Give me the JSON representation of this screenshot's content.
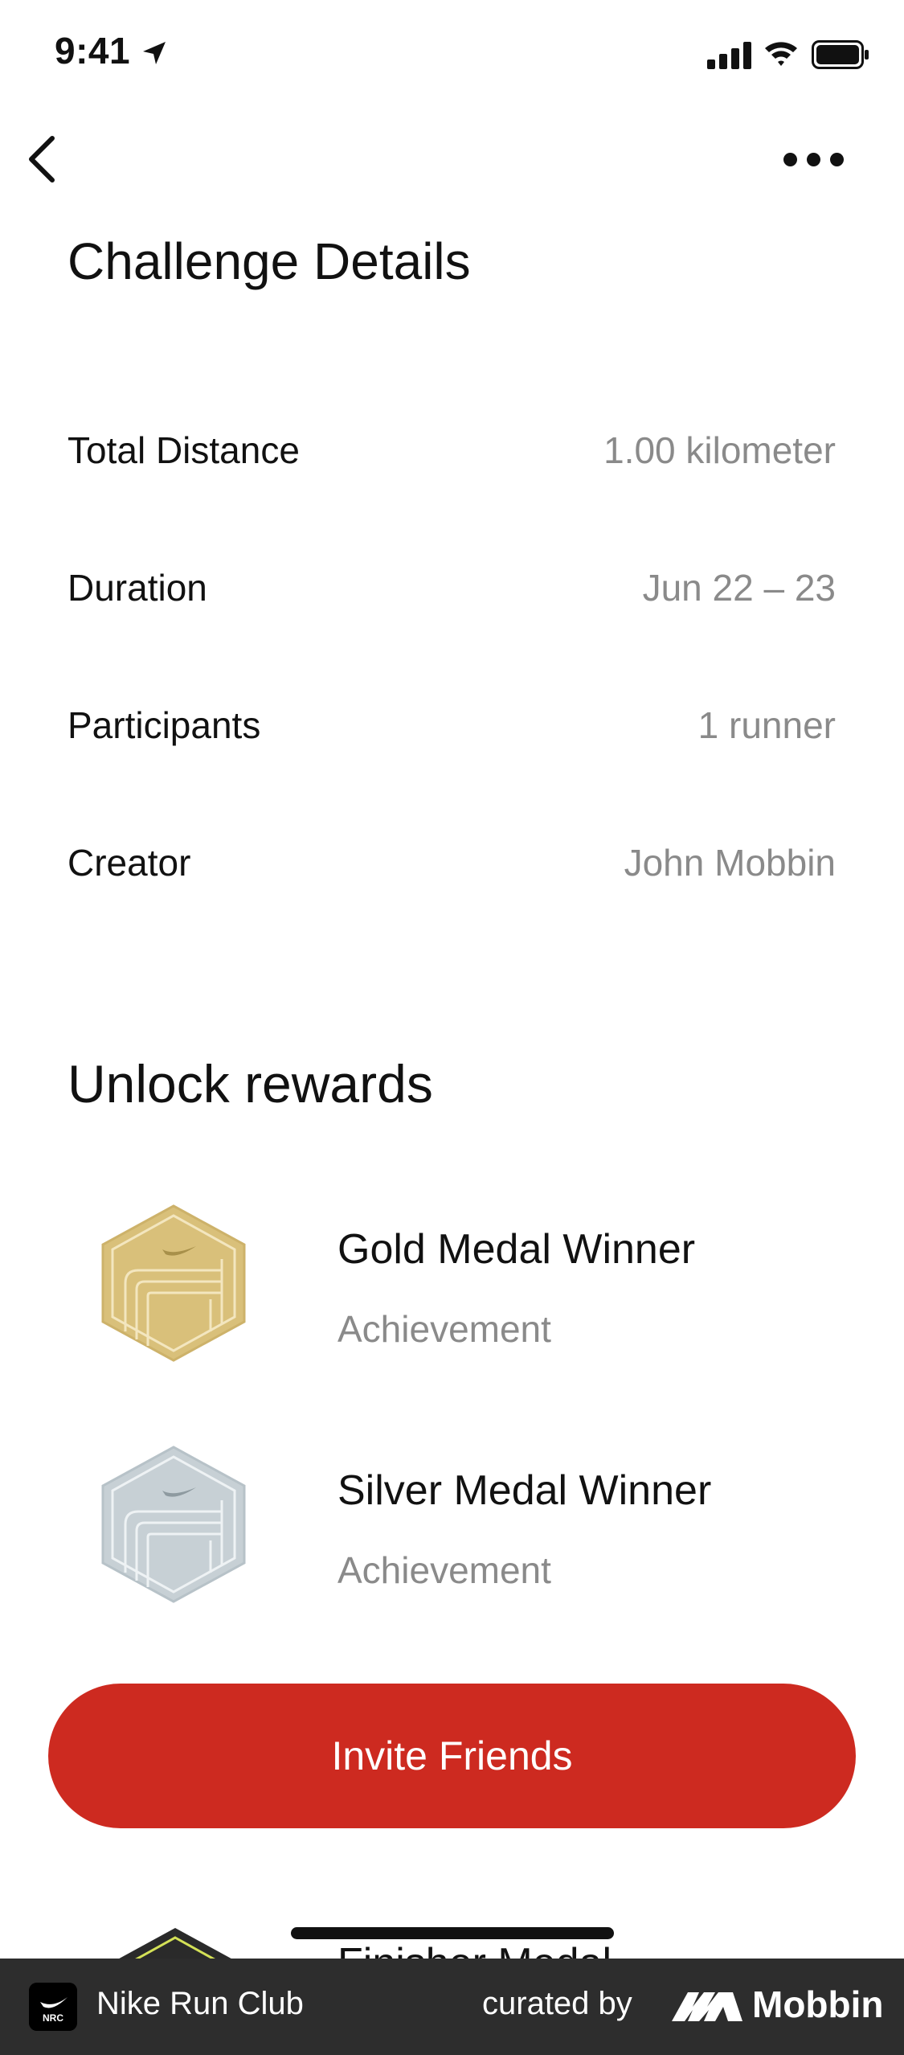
{
  "status_bar": {
    "time": "9:41"
  },
  "header": {
    "title": "Challenge Details"
  },
  "details": [
    {
      "label": "Total Distance",
      "value": "1.00 kilometer"
    },
    {
      "label": "Duration",
      "value": "Jun 22 – 23"
    },
    {
      "label": "Participants",
      "value": "1 runner"
    },
    {
      "label": "Creator",
      "value": "John Mobbin"
    }
  ],
  "rewards": {
    "title": "Unlock rewards",
    "items": [
      {
        "name": "Gold Medal Winner",
        "type": "Achievement",
        "color": "#d9c07a"
      },
      {
        "name": "Silver Medal Winner",
        "type": "Achievement",
        "color": "#c7d0d5"
      },
      {
        "name": "Finisher Medal"
      }
    ]
  },
  "cta": {
    "label": "Invite Friends",
    "color": "#cd2a20"
  },
  "footer": {
    "app_name": "Nike Run Club",
    "curated_label": "curated by",
    "brand": "Mobbin",
    "logo_text": "NRC"
  }
}
